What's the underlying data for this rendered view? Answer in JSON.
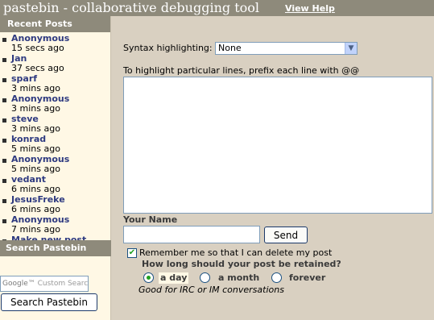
{
  "header": {
    "title": "pastebin - collaborative debugging tool",
    "help_link": "View Help"
  },
  "sidebar": {
    "recent_heading": "Recent Posts",
    "posts": [
      {
        "name": "Anonymous",
        "time": "15 secs ago"
      },
      {
        "name": "Jan",
        "time": "37 secs ago"
      },
      {
        "name": "sparf",
        "time": "3 mins ago"
      },
      {
        "name": "Anonymous",
        "time": "3 mins ago"
      },
      {
        "name": "steve",
        "time": "3 mins ago"
      },
      {
        "name": "konrad",
        "time": "5 mins ago"
      },
      {
        "name": "Anonymous",
        "time": "5 mins ago"
      },
      {
        "name": "vedant",
        "time": "6 mins ago"
      },
      {
        "name": "JesusFreke",
        "time": "6 mins ago"
      },
      {
        "name": "Anonymous",
        "time": "7 mins ago"
      }
    ],
    "new_post_link": "Make new post",
    "search_heading": "Search Pastebin",
    "search_logo": "Google™",
    "search_placeholder": "Custom Search",
    "search_button": "Search Pastebin"
  },
  "form": {
    "syntax_label": "Syntax highlighting:",
    "syntax_value": "None",
    "highlight_hint": "To highlight particular lines, prefix each line with @@",
    "code_value": "",
    "name_label": "Your Name",
    "name_value": "",
    "send_button": "Send",
    "remember_label": "Remember me so that I can delete my post",
    "remember_checked": true,
    "retain_question": "How long should your post be retained?",
    "retain_options": [
      {
        "label": "a day",
        "selected": true
      },
      {
        "label": "a month",
        "selected": false
      },
      {
        "label": "forever",
        "selected": false
      }
    ],
    "retain_note": "Good for IRC or IM conversations"
  },
  "colors": {
    "background": "#d9d0c1",
    "header_bar": "#8e8a7b",
    "sidebar_bg": "#fff8e5",
    "link": "#2e3a80",
    "radio_dot": "#21a121"
  }
}
